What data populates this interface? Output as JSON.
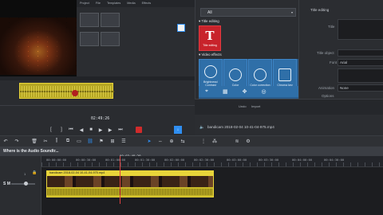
{
  "media_pool": {
    "tabs": [
      "Project",
      "File",
      "Templates",
      "Media",
      "Effects"
    ],
    "timecode": "02:49:26"
  },
  "effects": {
    "dropdown_value": "All",
    "title_editing_label": "Title editing",
    "title_editing_tile": "Title editing",
    "video_effects_label": "Video effects",
    "tiles": [
      "Brightness/ Contrast",
      "Color",
      "Color correction",
      "Chroma key"
    ]
  },
  "title_props": {
    "header": "Title editing",
    "title_label": "Title",
    "title_object_label": "Title object",
    "font_label": "Font",
    "font_value": "Arial",
    "animation_label": "Animation",
    "animation_value": "None",
    "options_label": "Options"
  },
  "bottom_bar": {
    "tabs": [
      "Undo",
      "Import"
    ],
    "file_path": "bandicam 2018-02-04 10-41-04-975.mp4"
  },
  "track_header": {
    "title": "Where is the Audio Soundtr..."
  },
  "timeline": {
    "playhead_time": "00:02:49:29",
    "ruler_ticks": [
      "00:00:00:00",
      "00:00:30:00",
      "00:01:00:00",
      "00:01:30:00",
      "00:02:00:00",
      "00:02:30:00",
      "00:03:00:00",
      "00:03:30:00",
      "00:04:00:00",
      "00:04:30:00"
    ],
    "clip_label": "bandicam 2018-02-04 10-41-04-975.mp4",
    "track_label": "S M"
  }
}
